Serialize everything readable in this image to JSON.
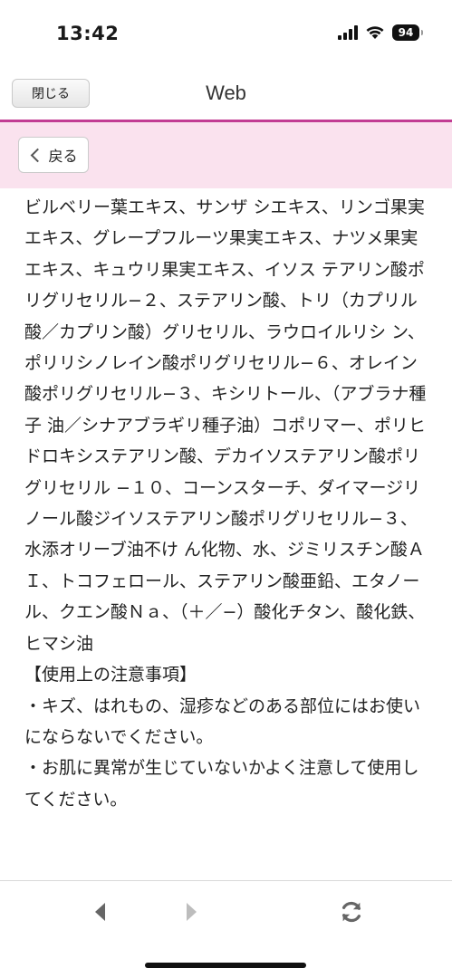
{
  "status_bar": {
    "time": "13:42",
    "battery": "94",
    "icons": [
      "signal-icon",
      "wifi-icon",
      "battery-icon"
    ]
  },
  "header": {
    "close_label": "閉じる",
    "title": "Web"
  },
  "back_bar": {
    "back_label": "戻る"
  },
  "content": {
    "ingredients_text": "ビルベリー葉エキス、サンザ シエキス、リンゴ果実エキス、グレープフルーツ果実エキス、ナツメ果実エキス、キュウリ果実エキス、イソス テアリン酸ポリグリセリル−２、ステアリン酸、トリ（カプリル酸／カプリン酸）グリセリル、ラウロイルリシ ン、ポリリシノレイン酸ポリグリセリル−６、オレイン酸ポリグリセリル−３、キシリトール、（アブラナ種子 油／シナアブラギリ種子油）コポリマー、ポリヒドロキシステアリン酸、デカイソステアリン酸ポリグリセリル −１０、コーンスターチ、ダイマージリノール酸ジイソステアリン酸ポリグリセリル−３、水添オリーブ油不け ん化物、水、ジミリスチン酸ＡＩ、トコフェロール、ステアリン酸亜鉛、エタノール、クエン酸Ｎａ、（＋／−）酸化チタン、酸化鉄、ヒマシ油",
    "caution_heading": "【使用上の注意事項】",
    "caution_items": [
      "・キズ、はれもの、湿疹などのある部位にはお使いにならないでください。",
      "・お肌に異常が生じていないかよく注意して使用してください。"
    ]
  },
  "toolbar": {
    "icons": [
      "back-arrow-icon",
      "forward-arrow-icon",
      "reload-icon"
    ]
  },
  "colors": {
    "accent": "#c23c93",
    "back_bar_bg": "#fae2ee"
  }
}
